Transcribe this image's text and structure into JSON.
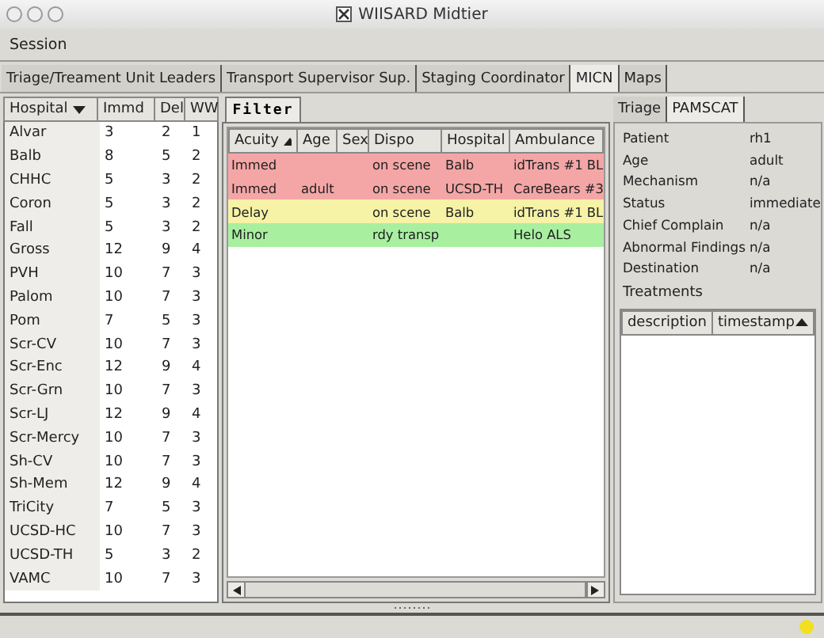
{
  "window": {
    "title": "WIISARD Midtier"
  },
  "menu": [
    "Session"
  ],
  "tabs": [
    {
      "label": "Triage/Treament Unit Leaders",
      "selected": false
    },
    {
      "label": "Transport Supervisor Sup.",
      "selected": false
    },
    {
      "label": "Staging Coordinator",
      "selected": false
    },
    {
      "label": "MICN",
      "selected": true
    },
    {
      "label": "Maps",
      "selected": false
    }
  ],
  "hospitals": {
    "columns": [
      {
        "label": "Hospital",
        "sort_up": false,
        "sort_down": true
      },
      {
        "label": "Immd",
        "sort_up": false,
        "sort_down": false
      },
      {
        "label": "Del",
        "sort_up": false,
        "sort_down": false
      },
      {
        "label": "WW",
        "sort_up": false,
        "sort_down": false
      }
    ],
    "rows": [
      [
        "Alvar",
        "3",
        "2",
        "1"
      ],
      [
        "Balb",
        "8",
        "5",
        "2"
      ],
      [
        "CHHC",
        "5",
        "3",
        "2"
      ],
      [
        "Coron",
        "5",
        "3",
        "2"
      ],
      [
        "Fall",
        "5",
        "3",
        "2"
      ],
      [
        "Gross",
        "12",
        "9",
        "4"
      ],
      [
        "PVH",
        "10",
        "7",
        "3"
      ],
      [
        "Palom",
        "10",
        "7",
        "3"
      ],
      [
        "Pom",
        "7",
        "5",
        "3"
      ],
      [
        "Scr-CV",
        "10",
        "7",
        "3"
      ],
      [
        "Scr-Enc",
        "12",
        "9",
        "4"
      ],
      [
        "Scr-Grn",
        "10",
        "7",
        "3"
      ],
      [
        "Scr-LJ",
        "12",
        "9",
        "4"
      ],
      [
        "Scr-Mercy",
        "10",
        "7",
        "3"
      ],
      [
        "Sh-CV",
        "10",
        "7",
        "3"
      ],
      [
        "Sh-Mem",
        "12",
        "9",
        "4"
      ],
      [
        "TriCity",
        "7",
        "5",
        "3"
      ],
      [
        "UCSD-HC",
        "10",
        "7",
        "3"
      ],
      [
        "UCSD-TH",
        "5",
        "3",
        "2"
      ],
      [
        "VAMC",
        "10",
        "7",
        "3"
      ]
    ]
  },
  "filter_button": "Filter",
  "patients": {
    "columns": [
      {
        "label": "Acuity",
        "sort_up": true,
        "sort_down": false
      },
      {
        "label": "Age",
        "sort_up": false,
        "sort_down": false
      },
      {
        "label": "Sex",
        "sort_up": false,
        "sort_down": false
      },
      {
        "label": "Dispo",
        "sort_up": false,
        "sort_down": false
      },
      {
        "label": "Hospital",
        "sort_up": false,
        "sort_down": false
      },
      {
        "label": "Ambulance",
        "sort_up": false,
        "sort_down": false
      }
    ],
    "rows": [
      {
        "color": "#f4a6a6",
        "cells": [
          "Immed",
          "",
          "",
          "on scene",
          "Balb",
          "idTrans #1 BL"
        ]
      },
      {
        "color": "#f4a6a6",
        "cells": [
          "Immed",
          "adult",
          "",
          "on scene",
          "UCSD-TH",
          "CareBears #3"
        ]
      },
      {
        "color": "#f6f2a6",
        "cells": [
          "Delay",
          "",
          "",
          "on scene",
          "Balb",
          "idTrans #1 BL"
        ]
      },
      {
        "color": "#a8f0a0",
        "cells": [
          "Minor",
          "",
          "",
          "rdy transp",
          "",
          "Helo ALS"
        ]
      }
    ]
  },
  "detail_tabs": [
    {
      "label": "Triage",
      "selected": false
    },
    {
      "label": "PAMSCAT",
      "selected": true
    }
  ],
  "details": [
    {
      "label": "Patient",
      "value": "rh1"
    },
    {
      "label": "Age",
      "value": "adult"
    },
    {
      "label": "Mechanism",
      "value": "n/a"
    },
    {
      "label": "Status",
      "value": "immediate"
    },
    {
      "label": "Chief Complain",
      "value": "n/a"
    },
    {
      "label": "Abnormal Findings",
      "value": "n/a"
    },
    {
      "label": "Destination",
      "value": "n/a"
    }
  ],
  "treatments": {
    "label": "Treatments",
    "columns": [
      {
        "label": "description",
        "sort_up": false,
        "sort_down": false
      },
      {
        "label": "timestamp",
        "sort_up": true,
        "sort_down": false
      }
    ]
  }
}
